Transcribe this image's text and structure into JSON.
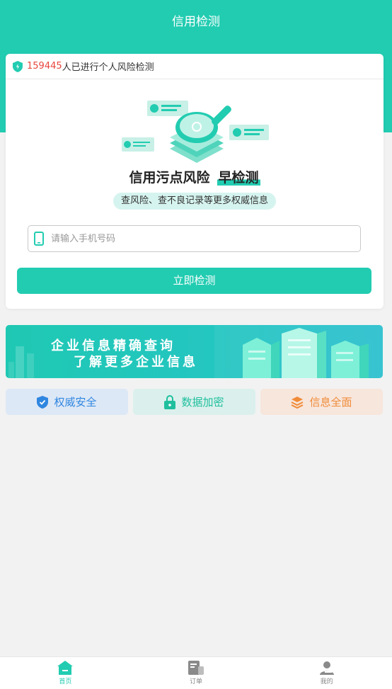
{
  "header": {
    "title": "信用检测"
  },
  "notice": {
    "count": "159445",
    "text": "人已进行个人风险检测"
  },
  "hero": {
    "headline_main": "信用污点风险",
    "headline_em": "早检测",
    "subtitle": "查风险、查不良记录等更多权威信息"
  },
  "form": {
    "phone_placeholder": "请输入手机号码",
    "phone_value": "",
    "submit_label": "立即检测"
  },
  "banner": {
    "line1": "企业信息精确查询",
    "line2": "了解更多企业信息"
  },
  "features": [
    {
      "label": "权威安全",
      "icon": "shield-check-icon"
    },
    {
      "label": "数据加密",
      "icon": "lock-icon"
    },
    {
      "label": "信息全面",
      "icon": "layers-icon"
    }
  ],
  "tabbar": [
    {
      "label": "首页",
      "icon": "home-icon",
      "active": true
    },
    {
      "label": "订单",
      "icon": "order-icon",
      "active": false
    },
    {
      "label": "我的",
      "icon": "user-icon",
      "active": false
    }
  ],
  "colors": {
    "primary": "#22ccb1",
    "count_red": "#e8453c",
    "blue": "#2f86e0",
    "orange": "#f08b38"
  }
}
